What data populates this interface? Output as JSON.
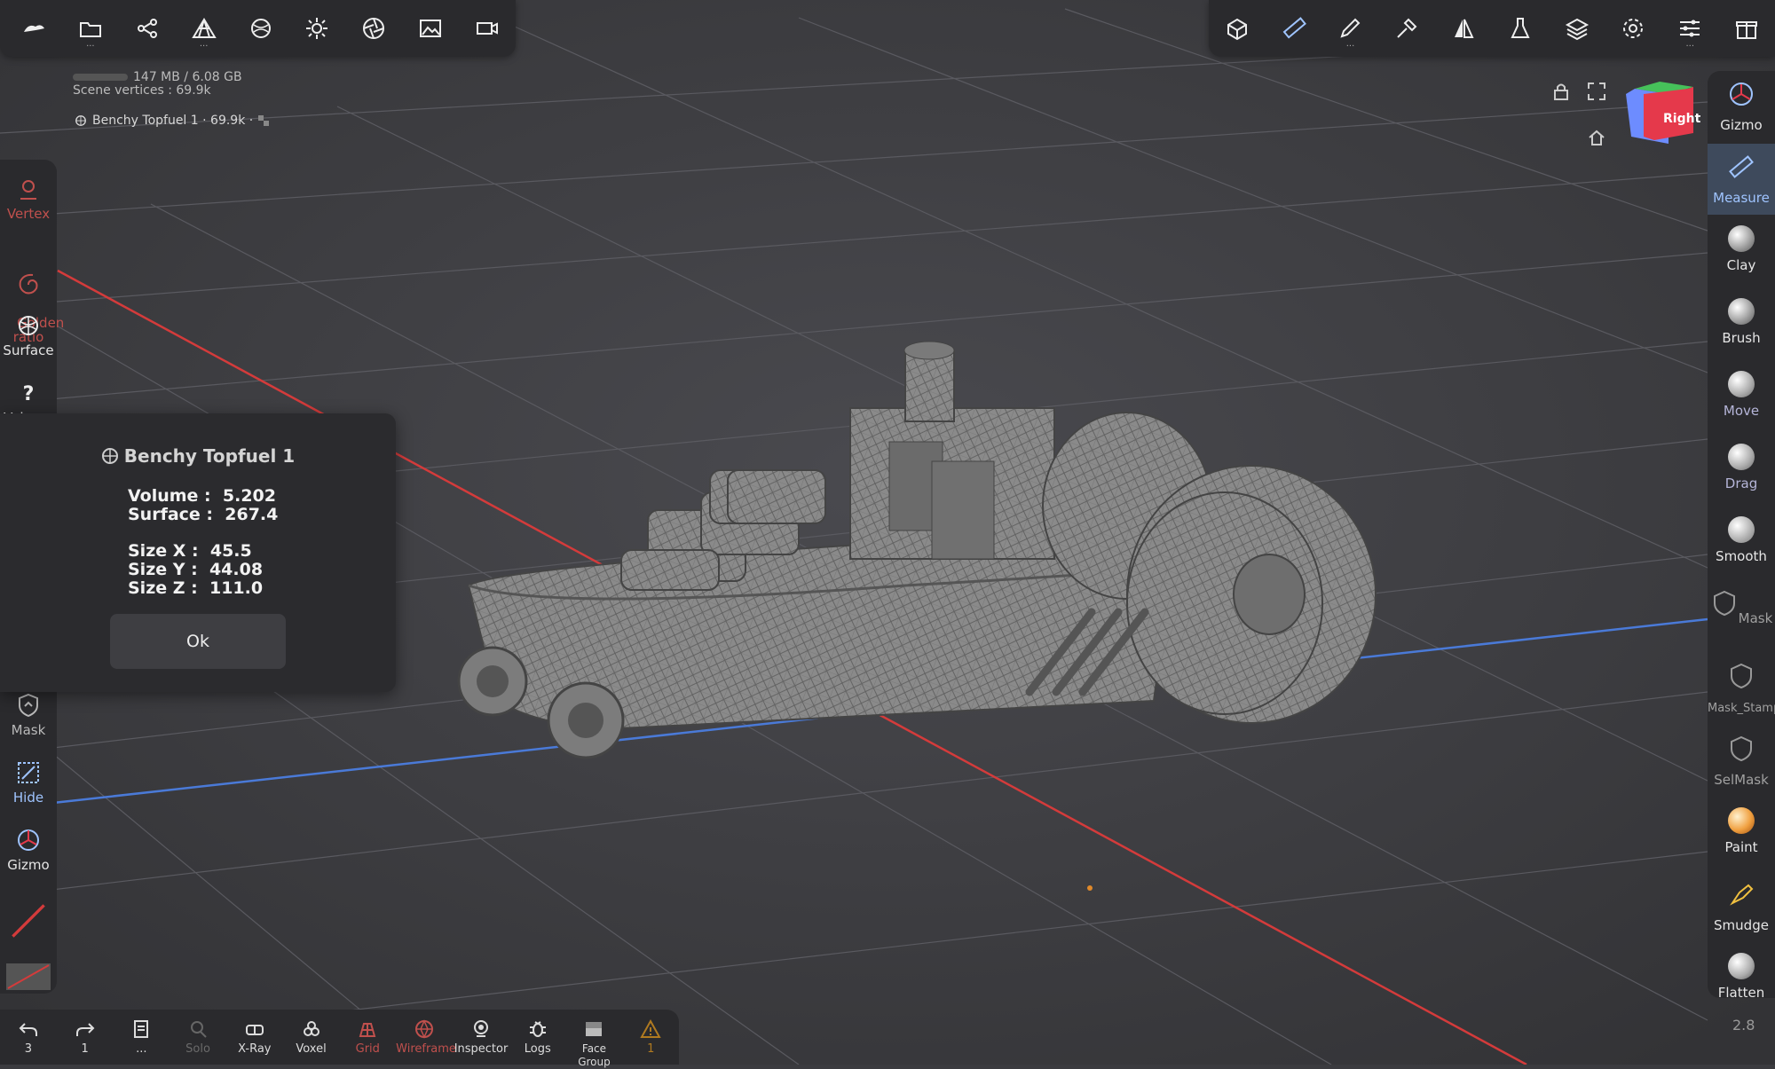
{
  "memory": "147 MB / 6.08 GB",
  "scene_vertices": "Scene vertices : 69.9k",
  "object_line": "Benchy Topfuel 1 · 69.9k ·",
  "top_left_icons": [
    "sculpt-logo-icon",
    "folder-icon",
    "scene-graph-icon",
    "topology-icon",
    "material-sphere-icon",
    "light-icon",
    "aperture-icon",
    "image-icon",
    "camera-icon"
  ],
  "top_right_icons": [
    "mesh-view-icon",
    "ruler-icon",
    "pencil-icon",
    "stroke-icon",
    "symmetry-icon",
    "flask-icon",
    "layers-icon",
    "settings-icon",
    "sliders-icon",
    "gift-icon"
  ],
  "left_sidebar": {
    "vertex": "Vertex",
    "golden": "Golden\nratio",
    "surface": "Surface",
    "volume": "Volume",
    "mask": "Mask",
    "hide": "Hide",
    "gizmo": "Gizmo"
  },
  "right_sidebar": {
    "gizmo": "Gizmo",
    "measure": "Measure",
    "clay": "Clay",
    "brush": "Brush",
    "move": "Move",
    "drag": "Drag",
    "smooth": "Smooth",
    "mask": "Mask",
    "mask_stamp": "Mask_Stamp",
    "selmask": "SelMask",
    "paint": "Paint",
    "smudge": "Smudge",
    "flatten": "Flatten"
  },
  "view_cube_label": "Right",
  "dialog": {
    "title": "Benchy Topfuel 1",
    "volume": "Volume :  5.202",
    "surface": "Surface :  267.4",
    "size_x": "Size X :  45.5",
    "size_y": "Size Y :  44.08",
    "size_z": "Size Z :  111.0",
    "ok": "Ok"
  },
  "bottom_toolbar": {
    "undo_count": "3",
    "redo_count": "1",
    "menu": "...",
    "solo": "Solo",
    "xray": "X-Ray",
    "voxel": "Voxel",
    "grid": "Grid",
    "wireframe": "Wireframe",
    "inspector": "Inspector",
    "logs": "Logs",
    "face_group": "Face Group",
    "warning_count": "1"
  },
  "version": "2.8",
  "colors": {
    "accent": "#9fc4ff",
    "x_axis": "#d43b3b",
    "z_axis": "#4a7ad8",
    "panel": "#2a2a2d"
  }
}
